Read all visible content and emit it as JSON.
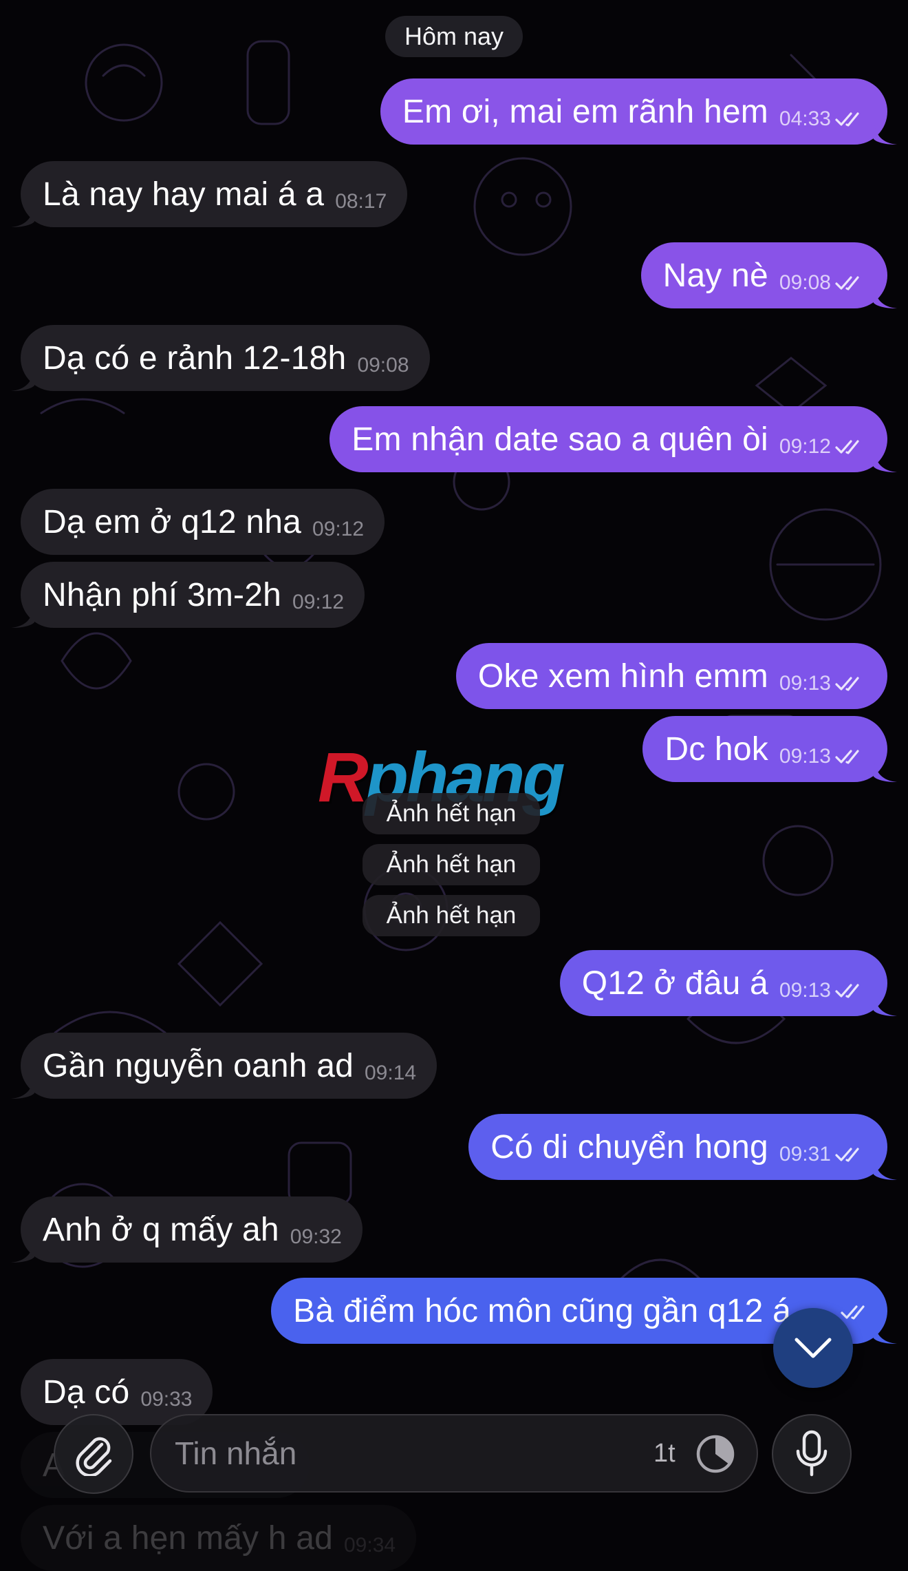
{
  "date_separator": "Hôm nay",
  "messages": [
    {
      "text": "Em ơi, mai em rãnh hem",
      "time": "04:33"
    },
    {
      "text": "Là nay hay mai á a",
      "time": "08:17"
    },
    {
      "text": "Nay nè",
      "time": "09:08"
    },
    {
      "text": "Dạ có e rảnh 12-18h",
      "time": "09:08"
    },
    {
      "text": "Em nhận date sao a quên òi",
      "time": "09:12"
    },
    {
      "text": "Dạ em ở q12 nha",
      "time": "09:12"
    },
    {
      "text": "Nhận phí 3m-2h",
      "time": "09:12"
    },
    {
      "text": "Oke xem hình emm",
      "time": "09:13"
    },
    {
      "text": "Dc hok",
      "time": "09:13"
    },
    {
      "text": "Q12 ở đâu á",
      "time": "09:13"
    },
    {
      "text": "Gần nguyễn oanh ad",
      "time": "09:14"
    },
    {
      "text": "Có di chuyển hong",
      "time": "09:31"
    },
    {
      "text": "Anh ở q mấy ah",
      "time": "09:32"
    },
    {
      "text": "Bà điểm hóc môn cũng gần q12 á",
      "time": ""
    },
    {
      "text": "Dạ có",
      "time": "09:33"
    },
    {
      "text": "A",
      "time": ""
    },
    {
      "text": "Với a hẹn mấy h ad",
      "time": "09:34"
    }
  ],
  "expired_photos": [
    "Ảnh hết hạn",
    "Ảnh hết hạn",
    "Ảnh hết hạn"
  ],
  "watermark": {
    "first": "R",
    "rest": "phang"
  },
  "composer": {
    "placeholder": "Tin nhắn",
    "timer_label": "1t"
  },
  "icons": {
    "attach": "paperclip-icon",
    "timer": "timer-icon",
    "mic": "microphone-icon",
    "scroll_down": "chevron-down-icon",
    "read_receipt": "double-check-icon"
  },
  "colors": {
    "background": "#050407",
    "incoming_bubble": "#222026",
    "outgoing_top": "#8a55e8",
    "outgoing_bottom": "#4a62ee",
    "scroll_button": "#1f3f80"
  }
}
